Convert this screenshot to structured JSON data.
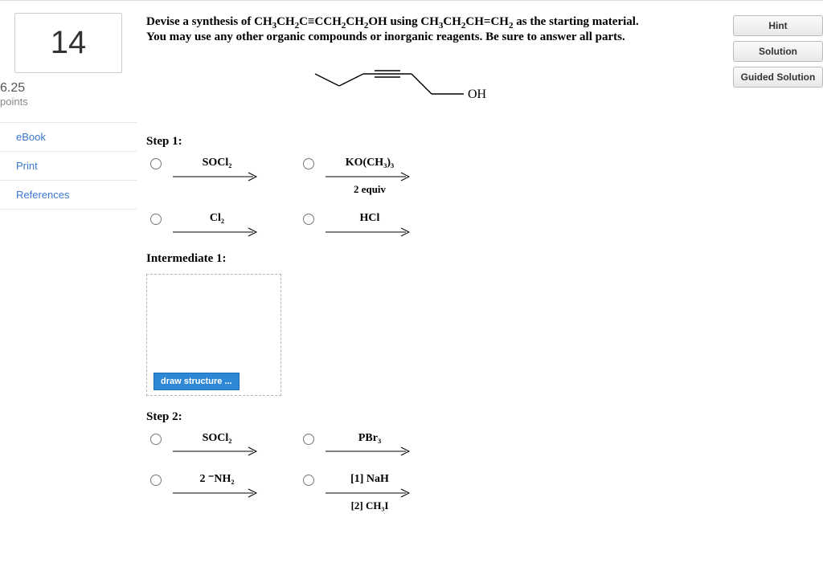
{
  "sidebar": {
    "question_number": "14",
    "points_value": "6.25",
    "points_label": "points",
    "links": {
      "ebook": "eBook",
      "print": "Print",
      "references": "References"
    }
  },
  "buttons": {
    "hint": "Hint",
    "solution": "Solution",
    "guided": "Guided Solution"
  },
  "question": {
    "line1_pre": "Devise a synthesis of CH",
    "line1_mid1": "CH",
    "line1_mid2": "C≡CCH",
    "line1_mid3": "CH",
    "line1_post": "OH using CH",
    "line1_post2": "CH",
    "line1_post3": "CH=CH",
    "line1_end": " as the starting material.",
    "line2": "You may use any other organic compounds or inorganic reagents. Be sure to answer all parts."
  },
  "molecule_label": "OH",
  "steps": {
    "step1_label": "Step 1:",
    "intermediate1_label": "Intermediate 1:",
    "step2_label": "Step 2:",
    "draw_button": "draw structure ...",
    "step1_options": {
      "a": {
        "label": "SOCl₂"
      },
      "b": {
        "label": "KO(CH₃)₃",
        "below": "2 equiv"
      },
      "c": {
        "label": "Cl₂"
      },
      "d": {
        "label": "HCl"
      }
    },
    "step2_options": {
      "a": {
        "label": "SOCl₂"
      },
      "b": {
        "label": "PBr₃"
      },
      "c": {
        "label": "2 ⁻NH₂"
      },
      "d": {
        "label": "[1] NaH",
        "below": "[2] CH₃I"
      }
    }
  }
}
